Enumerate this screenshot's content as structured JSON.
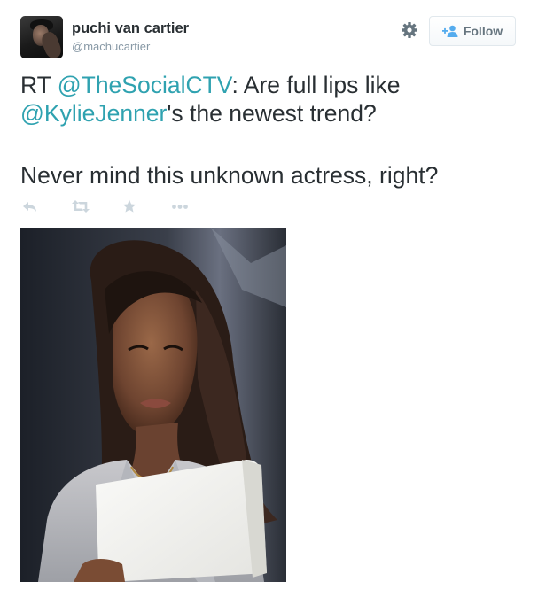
{
  "user": {
    "display_name": "puchi van cartier",
    "handle": "@machucartier",
    "avatar_icon": "user-avatar-photo"
  },
  "header": {
    "settings_icon": "gear-icon",
    "follow_label": "Follow",
    "follow_icon": "add-person-icon"
  },
  "tweet": {
    "prefix": "RT ",
    "mention_1": "@TheSocialCTV",
    "text_1": ": Are full lips like ",
    "mention_2": "@KylieJenner",
    "text_2": "'s the newest trend?",
    "line_2": "Never mind this unknown actress, right?"
  },
  "actions": {
    "reply_icon": "reply-icon",
    "retweet_icon": "retweet-icon",
    "favorite_icon": "star-icon",
    "more_icon": "more-dots-icon"
  },
  "media": {
    "image_icon": "attached-photo"
  },
  "colors": {
    "mention": "#2fa2b0",
    "text": "#292f33",
    "muted": "#8899a6",
    "icon": "#ccd6dd"
  }
}
